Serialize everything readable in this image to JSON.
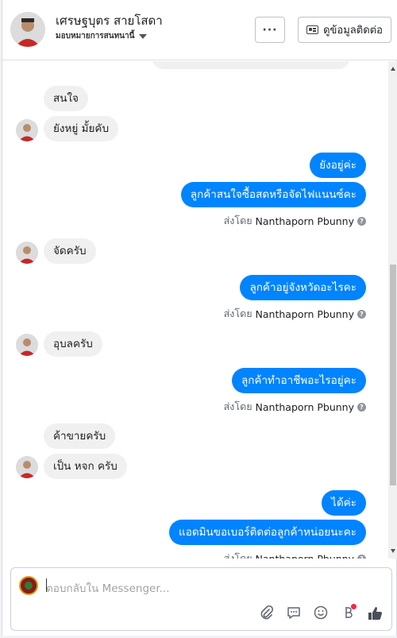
{
  "header": {
    "contact_name": "เศรษฐบุตร สายโสดา",
    "assign_label": "มอบหมายการสนทนานี้",
    "more_label": "···",
    "contact_info_label": "ดูข้อมูลติดต่อ"
  },
  "messages": [
    {
      "dir": "in",
      "text": "สนใจ"
    },
    {
      "dir": "in",
      "text": "ยังหยู่ มั้ยคับ"
    },
    {
      "dir": "out",
      "text": "ยังอยู่ค่ะ"
    },
    {
      "dir": "out",
      "text": "ลูกค้าสนใจซื้อสดหรือจัดไฟแนนซ์คะ"
    },
    {
      "dir": "in",
      "text": "จัดครับ"
    },
    {
      "dir": "out",
      "text": "ลูกค้าอยู่จังหวัดอะไรคะ"
    },
    {
      "dir": "in",
      "text": "อุบลครับ"
    },
    {
      "dir": "out",
      "text": "ลูกค้าทำอาชีพอะไรอยู่คะ"
    },
    {
      "dir": "in",
      "text": "ค้าขายครับ"
    },
    {
      "dir": "in",
      "text": "เป็น หจก ครับ"
    },
    {
      "dir": "out",
      "text": "ได้ค่ะ"
    },
    {
      "dir": "out",
      "text": "แอดมินขอเบอร์ติดต่อลูกค้าหน่อยนะคะ"
    }
  ],
  "sent_by": {
    "prefix": "ส่งโดย",
    "name": "Nanthaporn Pbunny",
    "help": "?"
  },
  "composer": {
    "placeholder": "ตอบกลับใน Messenger...",
    "icons": [
      "attachment-icon",
      "saved-replies-icon",
      "emoji-icon",
      "payment-icon",
      "thumbs-up-icon"
    ]
  },
  "colors": {
    "outgoing_bubble": "#0084ff",
    "incoming_bubble": "#f1f0f0"
  }
}
